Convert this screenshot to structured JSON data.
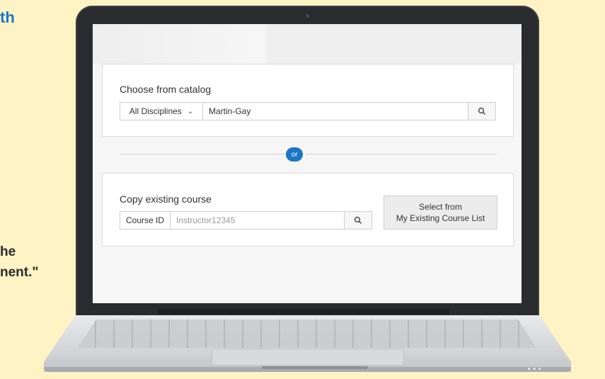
{
  "background_text": {
    "heading_fragment": "th",
    "line1_fragment": "he",
    "line2_fragment": "nent.\""
  },
  "catalog": {
    "heading": "Choose from catalog",
    "discipline_select": "All Disciplines",
    "search_value": "Martin-Gay",
    "search_icon": "search-icon",
    "chevron_icon": "chevron-down-icon"
  },
  "separator": {
    "or_label": "or"
  },
  "copy_course": {
    "heading": "Copy existing course",
    "course_id_label": "Course ID",
    "course_id_placeholder": "Instructor12345",
    "search_icon": "search-icon",
    "select_button_line1": "Select from",
    "select_button_line2": "My Existing Course List"
  },
  "colors": {
    "accent": "#1a75c7",
    "background": "#fdf3c4"
  }
}
